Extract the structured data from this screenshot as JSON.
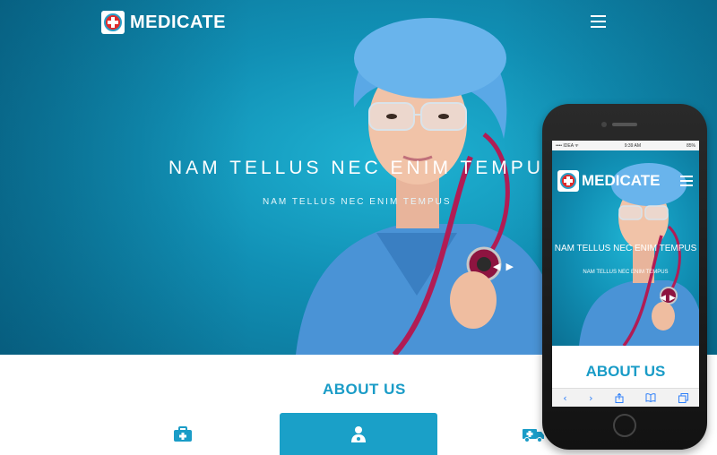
{
  "brand": {
    "name": "MEDICATE"
  },
  "hero": {
    "title": "NAM TELLUS NEC ENIM TEMPUS",
    "subtitle": "NAM TELLUS NEC ENIM TEMPUS",
    "prev_arrow": "◀",
    "next_arrow": "▶"
  },
  "about": {
    "title": "ABOUT US"
  },
  "features": [
    {
      "icon": "medkit-icon"
    },
    {
      "icon": "doctor-icon",
      "active": true
    },
    {
      "icon": "ambulance-icon"
    }
  ],
  "mobile": {
    "status": {
      "carrier": "•••• IDEA ᯤ",
      "time": "9:39 AM",
      "battery": "85%"
    },
    "brand_name": "MEDICATE",
    "hero_title": "NAM TELLUS NEC ENIM TEMPUS",
    "hero_subtitle": "NAM TELLUS NEC ENIM TEMPUS",
    "prev_arrow": "◀",
    "next_arrow": "▶",
    "about_title": "ABOUT US",
    "toolbar": {
      "back": "‹",
      "forward": "›"
    }
  },
  "colors": {
    "accent": "#1a9cc7",
    "hero_bg": "#1190b5",
    "logo_red": "#e02a2a"
  }
}
